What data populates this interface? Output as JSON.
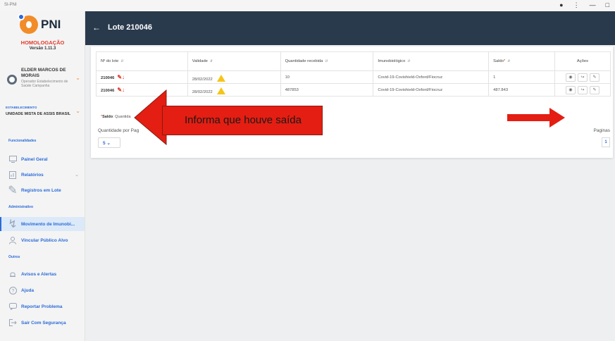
{
  "window": {
    "app_title": "SI-PNI",
    "controls": [
      "●",
      "⋮",
      "—",
      "□"
    ]
  },
  "sidebar": {
    "logo_text": "PNI",
    "environment": "HOMOLOGAÇÃO",
    "version": "Versão 1.11.3",
    "user": {
      "name": "ELDER MARCOS DE MORAIS",
      "role": "Operador Estabelecimento de Saúde Campanha"
    },
    "establishment": {
      "label": "ESTABELECIMENTO",
      "name": "UNIDADE MISTA DE ASSIS BRASIL"
    },
    "sections": {
      "funcionalidades": "Funcionalidades",
      "administrativo": "Administrativo",
      "outros": "Outros"
    },
    "items": {
      "painel": "Painel Geral",
      "relatorios": "Relatórios",
      "registros": "Registros em Lote",
      "movimento": "Movimento de Imunobi...",
      "vincular": "Vincular Público Alvo",
      "avisos": "Avisos e Alertas",
      "ajuda": "Ajuda",
      "reportar": "Reportar Problema",
      "sair": "Sair Com Segurança"
    }
  },
  "header": {
    "title": "Lote 210046"
  },
  "table": {
    "headers": {
      "lote": "Nº do lote",
      "validade": "Validade",
      "quantidade": "Quantidade recebida",
      "imuno": "Imunobiológico",
      "saldo": "Saldo",
      "acoes": "Ações"
    },
    "rows": [
      {
        "lote": "210046",
        "validade": "28/02/2022",
        "quantidade": "10",
        "imuno": "Covid-19-Covishield-Oxford/Fiocruz",
        "saldo": "1"
      },
      {
        "lote": "210046",
        "validade": "28/02/2022",
        "quantidade": "487853",
        "imuno": "Covid-19-Covishield-Oxford/Fiocruz",
        "saldo": "487.843"
      }
    ]
  },
  "footnote": {
    "bold": "Saldo",
    "rest": ": Quantida"
  },
  "pagination": {
    "qty_label": "Quantidade por Pag",
    "qty_value": "5",
    "pages_label": "Paginas",
    "current_page": "1"
  },
  "annotation": {
    "text": "Informa que houve saída",
    "color": "#e41e12"
  }
}
